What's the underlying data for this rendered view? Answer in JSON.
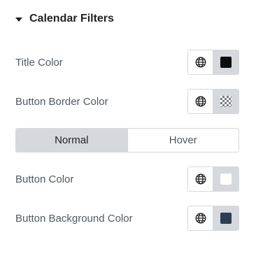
{
  "section": {
    "title": "Calendar Filters"
  },
  "controls": {
    "title_color": {
      "label": "Title Color",
      "swatch": "#0c0d0e"
    },
    "button_border_color": {
      "label": "Button Border Color",
      "swatch": "transparent"
    },
    "button_color": {
      "label": "Button Color",
      "swatch": "#ffffff"
    },
    "button_background_color": {
      "label": "Button Background Color",
      "swatch": "#2c3e50"
    }
  },
  "tabs": {
    "normal": "Normal",
    "hover": "Hover",
    "active": "normal"
  },
  "icons": {
    "section_toggle": "caret-down-icon",
    "global": "globe-icon"
  },
  "colors": {
    "control_border": "#d5d8dc",
    "active_tab_bg": "#d5d8dc",
    "label_text": "#515962",
    "heading_text": "#1f2124"
  }
}
